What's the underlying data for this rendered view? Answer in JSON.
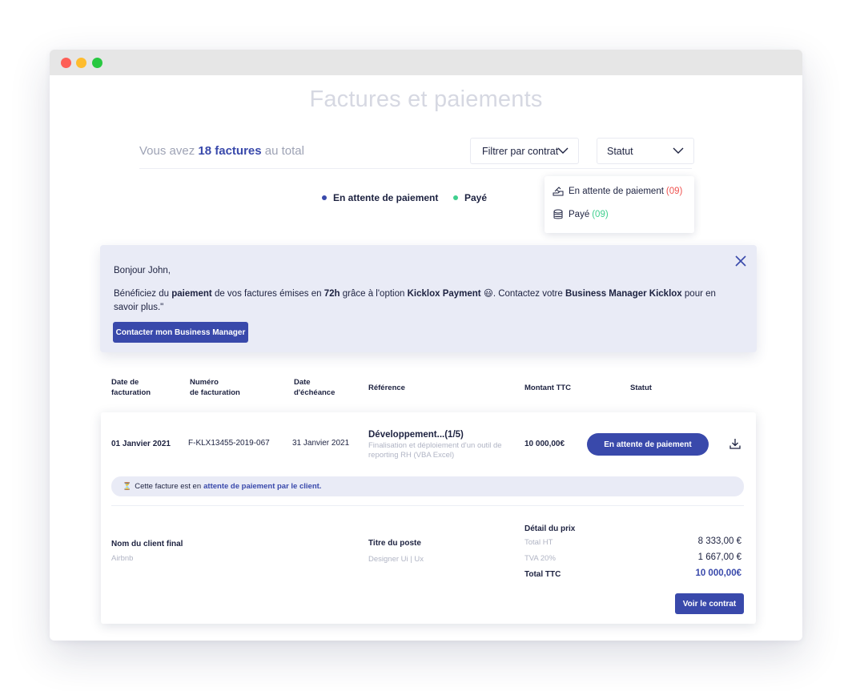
{
  "page": {
    "title": "Factures et paiements"
  },
  "summary": {
    "prefix": "Vous avez",
    "count_text": "18 factures",
    "suffix": "au total"
  },
  "filters": {
    "contract_label": "Filtrer par contrat",
    "status_label": "Statut"
  },
  "status_dropdown": {
    "items": [
      {
        "label": "En attente de paiement",
        "count": "(09)",
        "color": "#ef5350"
      },
      {
        "label": "Payé",
        "count": "(09)",
        "color": "#3fcf8e"
      }
    ]
  },
  "legend": {
    "items": [
      {
        "label": "En attente de paiement",
        "color": "#3949ab"
      },
      {
        "label": "Payé",
        "color": "#3fcf8e"
      }
    ]
  },
  "banner": {
    "greeting": "Bonjour John,",
    "message": {
      "p1": "Bénéficiez du ",
      "b1": "paiement",
      "p2": " de vos factures émises en ",
      "b2": "72h",
      "p3": " grâce à l'option ",
      "b3": "Kicklox Payment",
      "emoji": "😃",
      "p4": ". Contactez votre ",
      "b4": "Business Manager Kicklox",
      "p5": " pour en savoir plus.\""
    },
    "cta_label": "Contacter mon Business Manager"
  },
  "table": {
    "headers": {
      "date_line1": "Date de",
      "date_line2": "facturation",
      "number_line1": "Numéro",
      "number_line2": "de facturation",
      "due_line1": "Date",
      "due_line2": "d'échéance",
      "reference": "Référence",
      "amount": "Montant TTC",
      "status": "Statut"
    },
    "row": {
      "date": "01 Janvier 2021",
      "number": "F-KLX13455-2019-067",
      "due": "31 Janvier 2021",
      "ref_title": "Développement...(1/5)",
      "ref_sub": "Finalisation et déploiement d'un outil de reporting RH (VBA Excel)",
      "amount": "10 000,00€",
      "status": "En attente de paiement",
      "notice_prefix": "Cette facture est en",
      "notice_highlight": "attente de paiement par le client.",
      "client_label": "Nom du client final",
      "client_value": "Airbnb",
      "job_label": "Titre du poste",
      "job_value": "Designer Ui | Ux",
      "price_detail_label": "Détail du prix",
      "ht_label": "Total HT",
      "ht_value": "8 333,00 €",
      "tva_label": "TVA 20%",
      "tva_value": "1 667,00 €",
      "ttc_label": "Total TTC",
      "ttc_value": "10 000,00€",
      "contract_button": "Voir le contrat"
    }
  },
  "icons": {
    "chevron": "chevron-down-icon",
    "pending": "pending-payment-icon",
    "paid": "coins-stack-icon",
    "close": "close-icon",
    "download": "download-icon",
    "hourglass": "hourglass-icon"
  },
  "colors": {
    "accent": "#3949ab",
    "pending": "#ef5350",
    "paid": "#3fcf8e",
    "banner_bg": "#e9ebf6"
  }
}
